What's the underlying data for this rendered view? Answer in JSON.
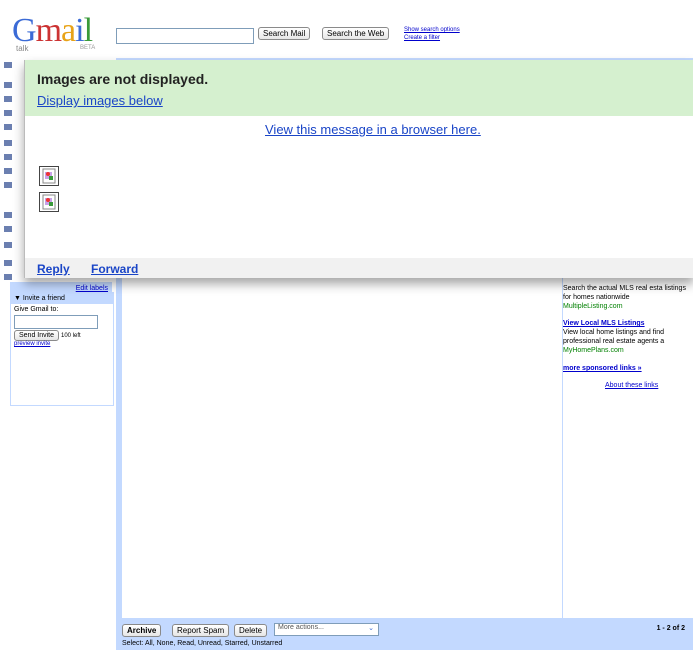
{
  "header": {
    "logo_text": "Gmail",
    "logo_sub": "talk",
    "logo_beta": "BETA",
    "search_mail_label": "Search Mail",
    "search_web_label": "Search the Web",
    "show_search_options": "Show search options",
    "create_filter": "Create a filter"
  },
  "sidebar": {
    "edit_labels": "Edit labels",
    "invite": {
      "header": "Invite a friend",
      "prompt": "Give Gmail to:",
      "send_label": "Send Invite",
      "left_count": "100 left",
      "preview": "preview invite"
    }
  },
  "popup": {
    "title": "Images are not displayed.",
    "display_link": "Display images below",
    "view_link": "View this message in a browser here.",
    "reply": "Reply",
    "forward": "Forward"
  },
  "ads": {
    "ad1_text": "Search the actual MLS real esta listings for homes nationwide",
    "ad1_url": "MultipleListing.com",
    "ad2_title": "View Local MLS Listings",
    "ad2_text": "View local home listings and find professional real estate agents a",
    "ad2_url": "MyHomePlans.com",
    "more": "more sponsored links »",
    "about": "About these links"
  },
  "toolbar": {
    "archive": "Archive",
    "report_spam": "Report Spam",
    "delete": "Delete",
    "more_actions": "More actions...",
    "count": "1 - 2 of 2",
    "select_text": "Select: All, None, Read, Unread, Starred, Unstarred"
  },
  "colors": {
    "accent_blue": "#c3d9ff",
    "banner_green": "#d5f0cf",
    "link_blue": "#1a45c7"
  }
}
